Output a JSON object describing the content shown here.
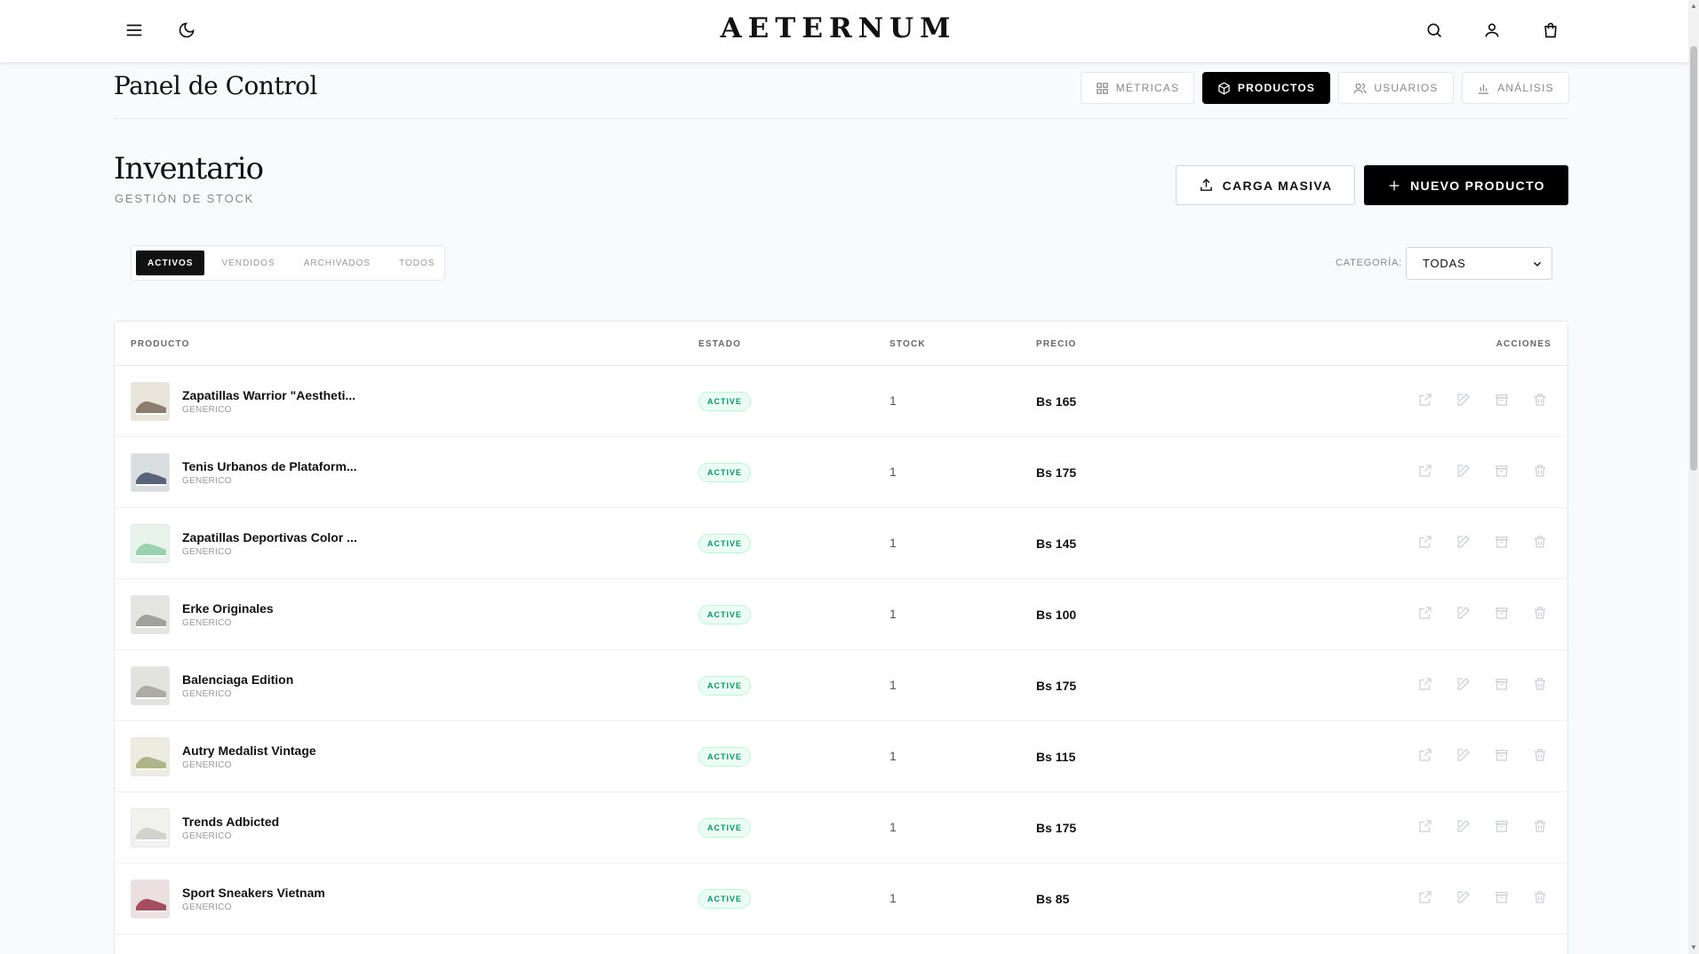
{
  "header": {
    "brand": "AETERNUM",
    "icons": [
      "menu-icon",
      "moon-icon",
      "search-icon",
      "user-icon",
      "cart-icon"
    ]
  },
  "page": {
    "title": "Panel de Control",
    "tabs": [
      {
        "label": "MÉTRICAS",
        "icon": "grid-icon",
        "active": false
      },
      {
        "label": "PRODUCTOS",
        "icon": "box-icon",
        "active": true
      },
      {
        "label": "USUARIOS",
        "icon": "users-icon",
        "active": false
      },
      {
        "label": "ANÁLISIS",
        "icon": "bar-chart-icon",
        "active": false
      }
    ]
  },
  "inventory": {
    "title": "Inventario",
    "subtitle": "GESTIÓN DE STOCK",
    "bulk_upload_label": "CARGA MASIVA",
    "new_product_label": "NUEVO PRODUCTO"
  },
  "filters": {
    "tabs": [
      {
        "label": "ACTIVOS",
        "active": true
      },
      {
        "label": "VENDIDOS",
        "active": false
      },
      {
        "label": "ARCHIVADOS",
        "active": false
      },
      {
        "label": "TODOS",
        "active": false
      }
    ],
    "category_label": "CATEGORÍA:",
    "category_value": "TODAS"
  },
  "table": {
    "columns": {
      "product": "PRODUCTO",
      "status": "ESTADO",
      "stock": "STOCK",
      "price": "PRECIO",
      "actions": "ACCIONES"
    },
    "rows": [
      {
        "name": "Zapatillas Warrior \"Aestheti...",
        "category": "GENERICO",
        "status": "ACTIVE",
        "stock": "1",
        "price": "Bs 165"
      },
      {
        "name": "Tenis Urbanos de Plataform...",
        "category": "GENERICO",
        "status": "ACTIVE",
        "stock": "1",
        "price": "Bs 175"
      },
      {
        "name": "Zapatillas Deportivas Color ...",
        "category": "GENERICO",
        "status": "ACTIVE",
        "stock": "1",
        "price": "Bs 145"
      },
      {
        "name": "Erke Originales",
        "category": "GENERICO",
        "status": "ACTIVE",
        "stock": "1",
        "price": "Bs 100"
      },
      {
        "name": "Balenciaga Edition",
        "category": "GENERICO",
        "status": "ACTIVE",
        "stock": "1",
        "price": "Bs 175"
      },
      {
        "name": "Autry Medalist Vintage",
        "category": "GENERICO",
        "status": "ACTIVE",
        "stock": "1",
        "price": "Bs 115"
      },
      {
        "name": "Trends Adbicted",
        "category": "GENERICO",
        "status": "ACTIVE",
        "stock": "1",
        "price": "Bs 175"
      },
      {
        "name": "Sport Sneakers Vietnam",
        "category": "GENERICO",
        "status": "ACTIVE",
        "stock": "1",
        "price": "Bs 85"
      }
    ],
    "row_action_icons": [
      "external-link-icon",
      "edit-icon",
      "archive-icon",
      "trash-icon"
    ]
  },
  "colors": {
    "accent": "#000000",
    "status_active_text": "#059669",
    "status_active_bg": "#ecfdf5"
  }
}
